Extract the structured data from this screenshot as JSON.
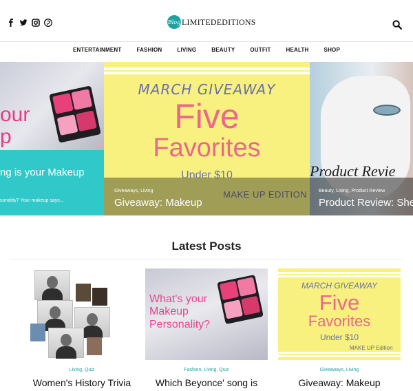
{
  "header": {
    "social": [
      {
        "icon": "facebook-icon",
        "glyph": "f"
      },
      {
        "icon": "twitter-icon"
      },
      {
        "icon": "instagram-icon"
      },
      {
        "icon": "pinterest-icon"
      }
    ],
    "logo_badge": "Blog",
    "logo_text": "LIMITEDEDITIONS",
    "search_icon": "search-icon"
  },
  "nav": {
    "items": [
      "ENTERTAINMENT",
      "FASHION",
      "LIVING",
      "BEAUTY",
      "OUTFIT",
      "HEALTH",
      "SHOP"
    ]
  },
  "carousel": {
    "left": {
      "word_top": "our",
      "word_bottom": "p",
      "title": "ng is your Makeup",
      "subtitle": "sonality? Your makeup says..."
    },
    "middle": {
      "kicker": "MARCH GIVEAWAY",
      "big1": "Five",
      "big2": "Favorites",
      "under": "Under $10",
      "edition": "MAKE UP EDITION",
      "categories": "Giveaways, Living",
      "title": "Giveaway: Makeup"
    },
    "right": {
      "word": "Product Revie",
      "categories": "Beauty, Living, Product Review",
      "title": "Product Review: She"
    }
  },
  "latest": {
    "heading": "Latest Posts",
    "cards": [
      {
        "categories": "Living, Quiz",
        "title": "Women's History Trivia"
      },
      {
        "categories": "Fashion, Living, Quiz",
        "title": "Which Beyonce' song is",
        "image_text": "What's your Makeup Personality?"
      },
      {
        "categories": "Giveaways, Living",
        "title": "Giveaway: Makeup",
        "kicker": "MARCH GIVEAWAY",
        "big1": "Five",
        "big2": "Favorites",
        "under": "Under $10",
        "edition": "MAKE UP Edition"
      }
    ]
  },
  "colors": {
    "teal": "#1aa2a0",
    "pink": "#e9688c",
    "yellow": "#f8f17f",
    "cyan_overlay": "#31c8c9"
  }
}
